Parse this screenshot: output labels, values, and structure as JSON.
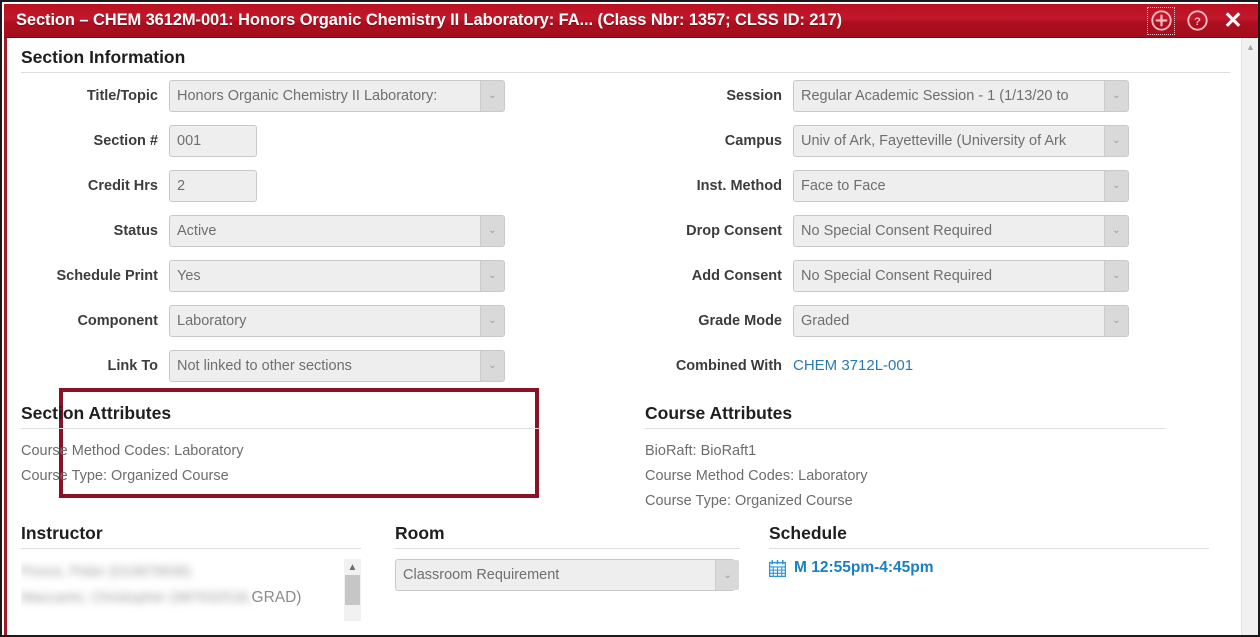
{
  "window": {
    "title": "Section – CHEM 3612M-001: Honors Organic Chemistry II Laboratory: FA... (Class Nbr: 1357; CLSS ID: 217)",
    "add_icon": "plus-circle-icon",
    "help_icon": "question-circle-icon",
    "close_icon": "close-icon",
    "close_glyph": "✕",
    "accent_color": "#b01326",
    "highlight_color": "#8a1226",
    "link_color": "#2a7ab0"
  },
  "section_information": {
    "heading": "Section Information",
    "left_fields": [
      {
        "label": "Title/Topic",
        "value": "Honors Organic Chemistry II Laboratory:",
        "type": "select",
        "width": "w-336"
      },
      {
        "label": "Section #",
        "value": "001",
        "type": "text",
        "width": "w-88"
      },
      {
        "label": "Credit Hrs",
        "value": "2",
        "type": "text",
        "width": "w-88"
      },
      {
        "label": "Status",
        "value": "Active",
        "type": "select",
        "width": "w-336"
      },
      {
        "label": "Schedule Print",
        "value": "Yes",
        "type": "select",
        "width": "w-336"
      },
      {
        "label": "Component",
        "value": "Laboratory",
        "type": "select",
        "width": "w-336"
      },
      {
        "label": "Link To",
        "value": "Not linked to other sections",
        "type": "select",
        "width": "w-336"
      }
    ],
    "right_fields": [
      {
        "label": "Session",
        "value": "Regular Academic Session - 1 (1/13/20 to",
        "type": "select",
        "width": "w-336"
      },
      {
        "label": "Campus",
        "value": "Univ of Ark, Fayetteville (University of Ark",
        "type": "select",
        "width": "w-336"
      },
      {
        "label": "Inst. Method",
        "value": "Face to Face",
        "type": "select",
        "width": "w-336"
      },
      {
        "label": "Drop Consent",
        "value": "No Special Consent Required",
        "type": "select",
        "width": "w-336"
      },
      {
        "label": "Add Consent",
        "value": "No Special Consent Required",
        "type": "select",
        "width": "w-336"
      },
      {
        "label": "Grade Mode",
        "value": "Graded",
        "type": "select",
        "width": "w-336"
      }
    ],
    "combined_with": {
      "label": "Combined With",
      "value": "CHEM 3712L-001"
    }
  },
  "section_attributes": {
    "heading": "Section Attributes",
    "lines": [
      "Course Method Codes: Laboratory",
      "Course Type: Organized Course"
    ]
  },
  "course_attributes": {
    "heading": "Course Attributes",
    "lines": [
      "BioRaft: BioRaft1",
      "Course Method Codes: Laboratory",
      "Course Type: Organized Course"
    ]
  },
  "instructor": {
    "heading": "Instructor",
    "rows": [
      {
        "redacted": "Ponce, Peter (010879636)",
        "suffix": ""
      },
      {
        "redacted": "Maccarini, Christopher (987632518,",
        "suffix": "GRAD)"
      }
    ]
  },
  "room": {
    "heading": "Room",
    "value": "Classroom Requirement"
  },
  "schedule": {
    "heading": "Schedule",
    "icon": "calendar-icon",
    "meeting": "M 12:55pm-4:45pm"
  }
}
